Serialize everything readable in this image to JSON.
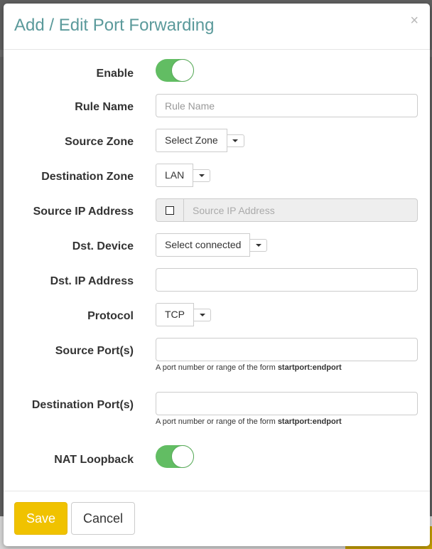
{
  "modal": {
    "title": "Add / Edit Port Forwarding",
    "close_label": "×"
  },
  "form": {
    "enable": {
      "label": "Enable",
      "value": true
    },
    "rule_name": {
      "label": "Rule Name",
      "placeholder": "Rule Name",
      "value": ""
    },
    "source_zone": {
      "label": "Source Zone",
      "selected": "Select Zone"
    },
    "destination_zone": {
      "label": "Destination Zone",
      "selected": "LAN"
    },
    "source_ip": {
      "label": "Source IP Address",
      "placeholder": "Source IP Address",
      "checked": false
    },
    "dst_device": {
      "label": "Dst. Device",
      "selected": "Select connected"
    },
    "dst_ip": {
      "label": "Dst. IP Address",
      "value": ""
    },
    "protocol": {
      "label": "Protocol",
      "selected": "TCP"
    },
    "source_ports": {
      "label": "Source Port(s)",
      "value": "",
      "help_prefix": "A port number or range of the form ",
      "help_bold": "startport:endport"
    },
    "destination_ports": {
      "label": "Destination Port(s)",
      "value": "",
      "help_prefix": "A port number or range of the form ",
      "help_bold": "startport:endport"
    },
    "nat_loopback": {
      "label": "NAT Loopback",
      "value": true
    }
  },
  "footer": {
    "save_label": "Save",
    "cancel_label": "Cancel"
  },
  "colors": {
    "title": "#5b9a9b",
    "toggle_on": "#62bd63",
    "save_button": "#f0c200"
  }
}
